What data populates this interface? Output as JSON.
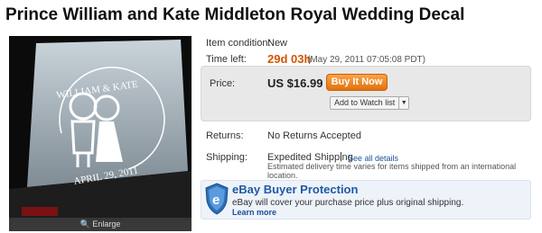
{
  "title": "Prince William and Kate Middleton Royal Wedding Decal",
  "image": {
    "decal_top_text": "WILLIAM & KATE",
    "decal_bottom_text": "APRIL 29, 2011",
    "enlarge_label": "Enlarge"
  },
  "item": {
    "condition_label": "Item condition:",
    "condition_value": "New",
    "time_left_label": "Time left:",
    "time_left_value": "29d 03h",
    "time_left_date": "(May 29, 2011 07:05:08 PDT)",
    "price_label": "Price:",
    "price_value": "US $16.99",
    "buy_now_label": "Buy It Now",
    "watch_list_label": "Add to Watch list",
    "returns_label": "Returns:",
    "returns_value": "No Returns Accepted",
    "shipping_label": "Shipping:",
    "shipping_value": "Expedited Shipping",
    "shipping_separator": "|",
    "see_all_label": "See all details",
    "shipping_note": "Estimated delivery time varies for items shipped from an international location."
  },
  "buyer_protection": {
    "title": "eBay Buyer Protection",
    "text": "eBay will cover your purchase price plus original shipping.",
    "learn_more": "Learn more",
    "badge_letter": "e"
  },
  "colors": {
    "time_left": "#d35400",
    "buy_button": "#ef8a24",
    "bp_title": "#1f5aa8",
    "link": "#1a4f9c"
  }
}
